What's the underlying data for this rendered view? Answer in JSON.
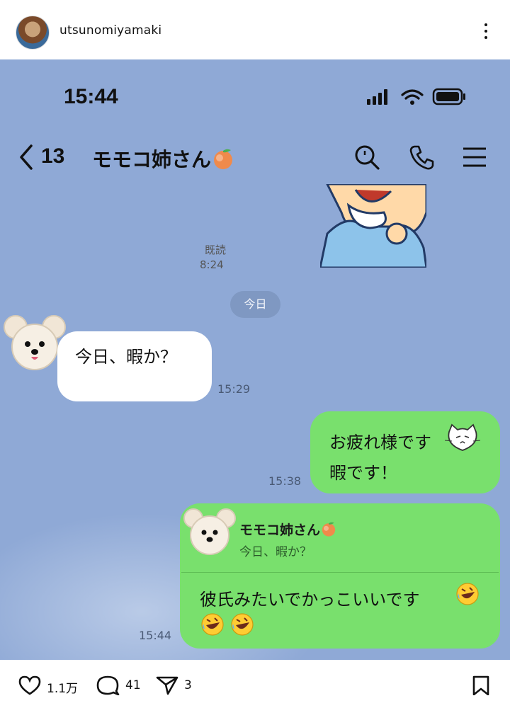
{
  "instagram": {
    "username": "utsunomiyamaki",
    "likes": "1.1万",
    "comments": "41",
    "shares": "3"
  },
  "status_bar": {
    "time": "15:44"
  },
  "line_header": {
    "unread_count": "13",
    "chat_title": "モモコ姉さん",
    "title_emoji": "peach-icon"
  },
  "chat": {
    "read_label": "既読",
    "read_time": "8:24",
    "date_separator": "今日",
    "messages": [
      {
        "side": "in",
        "text": "今日、暇か？",
        "time": "15:29"
      },
      {
        "side": "out",
        "lines": [
          "お疲れ様です",
          "暇です！"
        ],
        "time": "15:38"
      },
      {
        "side": "out",
        "reply_to_name": "モモコ姉さん",
        "reply_to_text": "今日、暇か？",
        "text": "彼氏みたいでかっこいいです",
        "time": "15:44"
      }
    ]
  },
  "colors": {
    "chat_bg": "#8fa9d6",
    "bubble_out": "#79e06d",
    "bubble_in": "#ffffff"
  }
}
